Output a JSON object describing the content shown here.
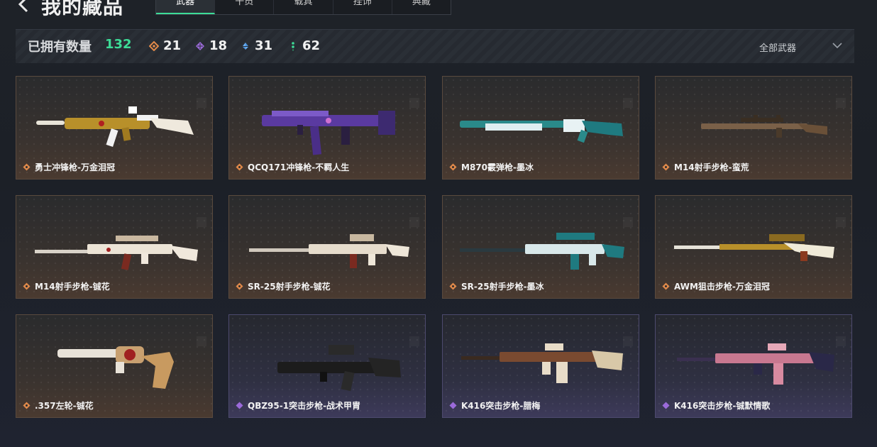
{
  "header": {
    "title": "我的藏品",
    "tabs": [
      {
        "label": "武器",
        "active": true
      },
      {
        "label": "干员",
        "active": false
      },
      {
        "label": "载具",
        "active": false
      },
      {
        "label": "挂饰",
        "active": false
      },
      {
        "label": "典藏",
        "active": false
      }
    ]
  },
  "summary": {
    "owned_label": "已拥有数量",
    "owned_count": "132",
    "rarity_counts": [
      {
        "icon": "orange-diamond-icon",
        "count": "21",
        "color": "#e0894a"
      },
      {
        "icon": "purple-diamond-icon",
        "count": "18",
        "color": "#9b6ad9"
      },
      {
        "icon": "blue-diamond-icon",
        "count": "31",
        "color": "#4a90d9"
      },
      {
        "icon": "green-dots-icon",
        "count": "62",
        "color": "#3ddc97"
      }
    ],
    "filter": "全部武器"
  },
  "colors": {
    "accent": "#3ddc97",
    "orange_rarity": "#e0894a",
    "purple_rarity": "#9b6ad9"
  },
  "items": [
    {
      "name": "勇士冲锋枪-万金泪冠",
      "rarity": "orange",
      "skin": "gold"
    },
    {
      "name": "QCQ171冲锋枪-不羁人生",
      "rarity": "orange",
      "skin": "violet"
    },
    {
      "name": "M870霰弹枪-墨冰",
      "rarity": "orange",
      "skin": "ice"
    },
    {
      "name": "M14射手步枪-蛮荒",
      "rarity": "orange",
      "skin": "rust"
    },
    {
      "name": "M14射手步枪-铖花",
      "rarity": "orange",
      "skin": "whitered"
    },
    {
      "name": "SR-25射手步枪-铖花",
      "rarity": "orange",
      "skin": "whitered"
    },
    {
      "name": "SR-25射手步枪-墨冰",
      "rarity": "orange",
      "skin": "ice"
    },
    {
      "name": "AWM狙击步枪-万金泪冠",
      "rarity": "orange",
      "skin": "gold"
    },
    {
      "name": ".357左轮-铖花",
      "rarity": "orange",
      "skin": "whitered"
    },
    {
      "name": "QBZ95-1突击步枪-战术甲胄",
      "rarity": "purple",
      "skin": "black"
    },
    {
      "name": "K416突击步枪-腊梅",
      "rarity": "purple",
      "skin": "cream"
    },
    {
      "name": "K416突击步枪-铖默情歌",
      "rarity": "purple",
      "skin": "pink"
    }
  ]
}
